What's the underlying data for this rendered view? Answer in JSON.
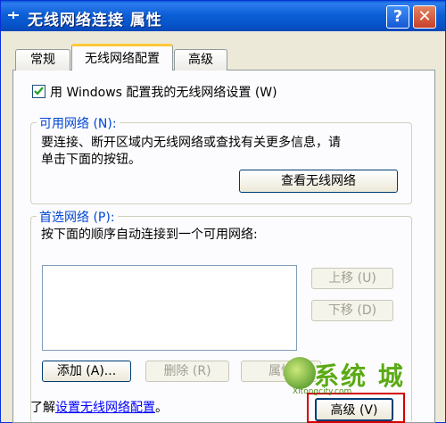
{
  "window": {
    "title": "无线网络连接 属性",
    "help_glyph": "?",
    "close_glyph": "✕"
  },
  "tabs": [
    {
      "label": "常规"
    },
    {
      "label": "无线网络配置"
    },
    {
      "label": "高级"
    }
  ],
  "config": {
    "use_windows_label": "用 Windows 配置我的无线网络设置 (W)",
    "use_windows_checked": true
  },
  "available": {
    "title": "可用网络 (N):",
    "description_line1": "要连接、断开区域内无线网络或查找有关更多信息，请",
    "description_line2": "单击下面的按钮。",
    "view_button": "查看无线网络"
  },
  "preferred": {
    "title": "首选网络 (P):",
    "description": "按下面的顺序自动连接到一个可用网络:",
    "move_up": "上移 (U)",
    "move_down": "下移 (D)",
    "add": "添加 (A)...",
    "remove": "删除 (R)",
    "properties": "属性"
  },
  "footer": {
    "learn_prefix": "了解",
    "learn_link": "设置无线网络配置",
    "learn_suffix": "。",
    "advanced_button": "高级 (V)"
  },
  "watermark": {
    "text": "系统 城",
    "sub": "Xitongcity.com"
  },
  "colors": {
    "titlebar": "#0c5fd6",
    "group_title": "#0046d5",
    "highlight": "#d40000"
  }
}
